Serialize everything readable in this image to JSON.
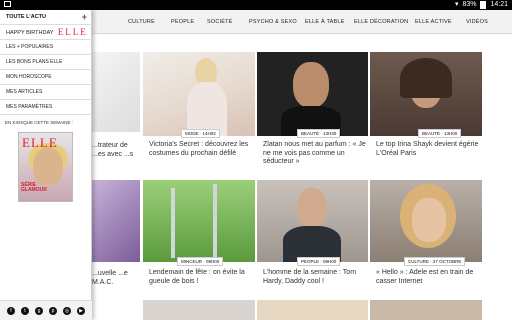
{
  "status_bar": {
    "battery": "83%",
    "time": "14:21"
  },
  "nav": {
    "items": [
      "CULTURE",
      "PEOPLE",
      "SOCIÉTÉ",
      "PSYCHO & SEXO",
      "ELLE À TABLE",
      "ELLE DÉCORATION",
      "ELLE ACTIVE",
      "VIDÉOS"
    ]
  },
  "drawer": {
    "items": [
      {
        "label": "TOUTE L'ACTU",
        "action": "+"
      },
      {
        "label": "HAPPY BIRTHDAY",
        "logo": "ELLE"
      },
      {
        "label": "LES + POPULAIRES"
      },
      {
        "label": "LES BONS PLANS ELLE"
      },
      {
        "label": "MON HOROSCOPE"
      },
      {
        "label": "MES ARTICLES"
      },
      {
        "label": "MES PARAMÈTRES"
      }
    ],
    "kiosque_label": "EN KIOSQUE CETTE SEMAINE :",
    "cover_title": "ELLE",
    "cover_caption": "SÉRIE\nGLAMOUR",
    "social_icons": [
      "facebook-icon",
      "twitter-icon",
      "googleplus-icon",
      "pinterest-icon",
      "instagram-icon",
      "youtube-icon"
    ]
  },
  "articles": [
    {
      "tag": "",
      "title": "...trateur de ...es avec ...s"
    },
    {
      "tag": "MODE · 14H02",
      "title": "Victoria's Secret : découvrez les costumes du prochain défilé"
    },
    {
      "tag": "BEAUTÉ · 13H30",
      "title": "Zlatan nous met au parfum : « Je ne me vois pas comme un séducteur »"
    },
    {
      "tag": "BEAUTÉ · 13H00",
      "title": "Le top Irina Shayk devient égérie L'Oréal Paris"
    },
    {
      "tag": "",
      "title": "...uvelle ...e M.A.C."
    },
    {
      "tag": "MINCEUR · 09H00",
      "title": "Lendemain de fête : on évite la gueule de bois !"
    },
    {
      "tag": "PEOPLE · 09H00",
      "title": "L'homme de la semaine : Tom Hardy, Daddy cool !"
    },
    {
      "tag": "CULTURE · 27 OCTOBRE",
      "title": "« Hello » : Adele est en train de casser Internet"
    }
  ]
}
